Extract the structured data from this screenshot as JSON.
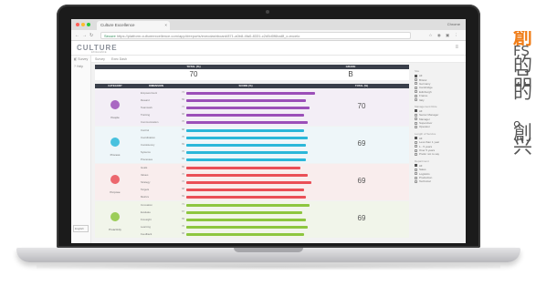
{
  "browser": {
    "tab_title": "Culture Excellence",
    "user_label": "Chrome",
    "secure_label": "Secure",
    "url": "https://platform.cultureexcellence.com/app/#/reports/execdashboard/871-a0b8-4fa0-8331-c2d5d0f6ba8f_o-excelo"
  },
  "app": {
    "logo": "CULTURE",
    "logo_sub": "EXCELLENCE",
    "sidebar": [
      "Survey",
      "Help"
    ],
    "sidebar_bottom": "English",
    "subtabs": [
      "Survey",
      "Exec Dash"
    ]
  },
  "summary": {
    "headers": [
      "TOTAL (%)",
      "GRADE"
    ],
    "total": "70",
    "grade": "B"
  },
  "grid": {
    "headers": [
      "CATEGORY",
      "DIMENSION",
      "SCORE (%)",
      "TOTAL (%)"
    ],
    "categories": [
      {
        "name": "People",
        "color": "#9b4fb8",
        "bg": "#f3eef6",
        "total": "70",
        "dims": [
          "Empowerment",
          "Reward",
          "Teamwork",
          "Training",
          "Communication"
        ],
        "values": [
          74,
          69,
          71,
          68,
          70
        ]
      },
      {
        "name": "Process",
        "color": "#2bb7d9",
        "bg": "#eef6f9",
        "total": "69",
        "dims": [
          "Control",
          "Coordination",
          "Consistency",
          "Systems",
          "Processes"
        ],
        "values": [
          68,
          70,
          69,
          70,
          69
        ]
      },
      {
        "name": "Purpose",
        "color": "#ea4f57",
        "bg": "#f9eded",
        "total": "69",
        "dims": [
          "Goals",
          "Values",
          "Strategy",
          "Targets",
          "Metrics"
        ],
        "values": [
          66,
          70,
          72,
          68,
          69
        ]
      },
      {
        "name": "Proactivity",
        "color": "#8dc63f",
        "bg": "#f1f5ea",
        "total": "69",
        "dims": [
          "Innovation",
          "Evaluate",
          "Foresight",
          "Learning",
          "Feedback"
        ],
        "values": [
          71,
          67,
          69,
          70,
          68
        ]
      }
    ]
  },
  "filters": [
    {
      "title": "Site",
      "options": [
        {
          "label": "All",
          "on": true
        },
        {
          "label": "Bristol",
          "on": false
        },
        {
          "label": "Germany",
          "on": false
        },
        {
          "label": "Cambridge",
          "on": false
        },
        {
          "label": "Edinburgh",
          "on": false
        },
        {
          "label": "France",
          "on": false
        },
        {
          "label": "Italy",
          "on": false
        }
      ]
    },
    {
      "title": "Management Role",
      "options": [
        {
          "label": "All",
          "on": true
        },
        {
          "label": "Senior Manager",
          "on": false
        },
        {
          "label": "Manager",
          "on": false
        },
        {
          "label": "Supervisor",
          "on": false
        },
        {
          "label": "Operator",
          "on": false
        }
      ]
    },
    {
      "title": "Length of Service",
      "options": [
        {
          "label": "All",
          "on": true
        },
        {
          "label": "Less than 1 year",
          "on": false
        },
        {
          "label": "1 - 5 years",
          "on": false
        },
        {
          "label": "Over 5 years",
          "on": false
        },
        {
          "label": "Prefer not to say",
          "on": false
        }
      ]
    },
    {
      "title": "Department",
      "options": [
        {
          "label": "All",
          "on": true
        },
        {
          "label": "Sales",
          "on": false
        },
        {
          "label": "Logistics",
          "on": false
        },
        {
          "label": "Production",
          "on": false
        },
        {
          "label": "Technical",
          "on": false
        }
      ]
    }
  ],
  "side_text": [
    "創",
    "FS",
    "的",
    "品",
    "的",
    "",
    "。",
    "創",
    "兴"
  ]
}
